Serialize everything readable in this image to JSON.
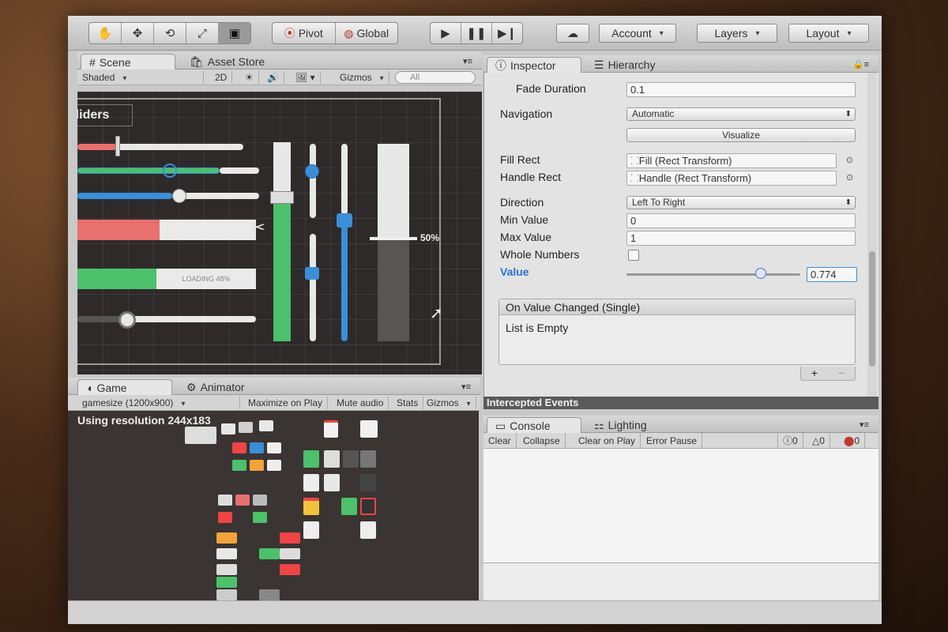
{
  "toolbar": {
    "tools": [
      "hand-icon",
      "move-icon",
      "rotate-icon",
      "scale-icon",
      "rect-icon"
    ],
    "pivot_label": "Pivot",
    "global_label": "Global",
    "account_label": "Account",
    "layers_label": "Layers",
    "layout_label": "Layout"
  },
  "scene": {
    "tab_scene": "Scene",
    "tab_asset_store": "Asset Store",
    "shading_mode": "Shaded",
    "mode_2d": "2D",
    "gizmos_label": "Gizmos",
    "search_placeholder": "All",
    "title_text": "Sliders",
    "loading_text": "LOADING 48%",
    "percent_label": "50%"
  },
  "game": {
    "tab_game": "Game",
    "tab_animator": "Animator",
    "resolution_select": "gamesize (1200x900)",
    "maximize_on_play": "Maximize on Play",
    "mute_audio": "Mute audio",
    "stats": "Stats",
    "gizmos": "Gizmos",
    "resolution_text": "Using resolution 244x183"
  },
  "inspector": {
    "tab_inspector": "Inspector",
    "tab_hierarchy": "Hierarchy",
    "fade_duration_label": "Fade Duration",
    "fade_duration_value": "0.1",
    "navigation_label": "Navigation",
    "navigation_value": "Automatic",
    "visualize_label": "Visualize",
    "fill_rect_label": "Fill Rect",
    "fill_rect_value": "Fill (Rect Transform)",
    "handle_rect_label": "Handle Rect",
    "handle_rect_value": "Handle (Rect Transform)",
    "direction_label": "Direction",
    "direction_value": "Left To Right",
    "min_value_label": "Min Value",
    "min_value": "0",
    "max_value_label": "Max Value",
    "max_value": "1",
    "whole_numbers_label": "Whole Numbers",
    "value_label": "Value",
    "value": "0.774",
    "value_fraction": 0.774,
    "event_title": "On Value Changed (Single)",
    "event_empty": "List is Empty",
    "add_symbol": "+",
    "remove_symbol": "−"
  },
  "intercepted": {
    "title": "Intercepted Events"
  },
  "console": {
    "tab_console": "Console",
    "tab_lighting": "Lighting",
    "clear": "Clear",
    "collapse": "Collapse",
    "clear_on_play": "Clear on Play",
    "error_pause": "Error Pause",
    "info_count": "0",
    "warning_count": "0",
    "error_count": "0"
  },
  "colors": {
    "accent_blue": "#3a8fd8",
    "slider_green": "#4cc06a",
    "slider_red": "#e8706e",
    "value_label_blue": "#2a6fd6"
  }
}
